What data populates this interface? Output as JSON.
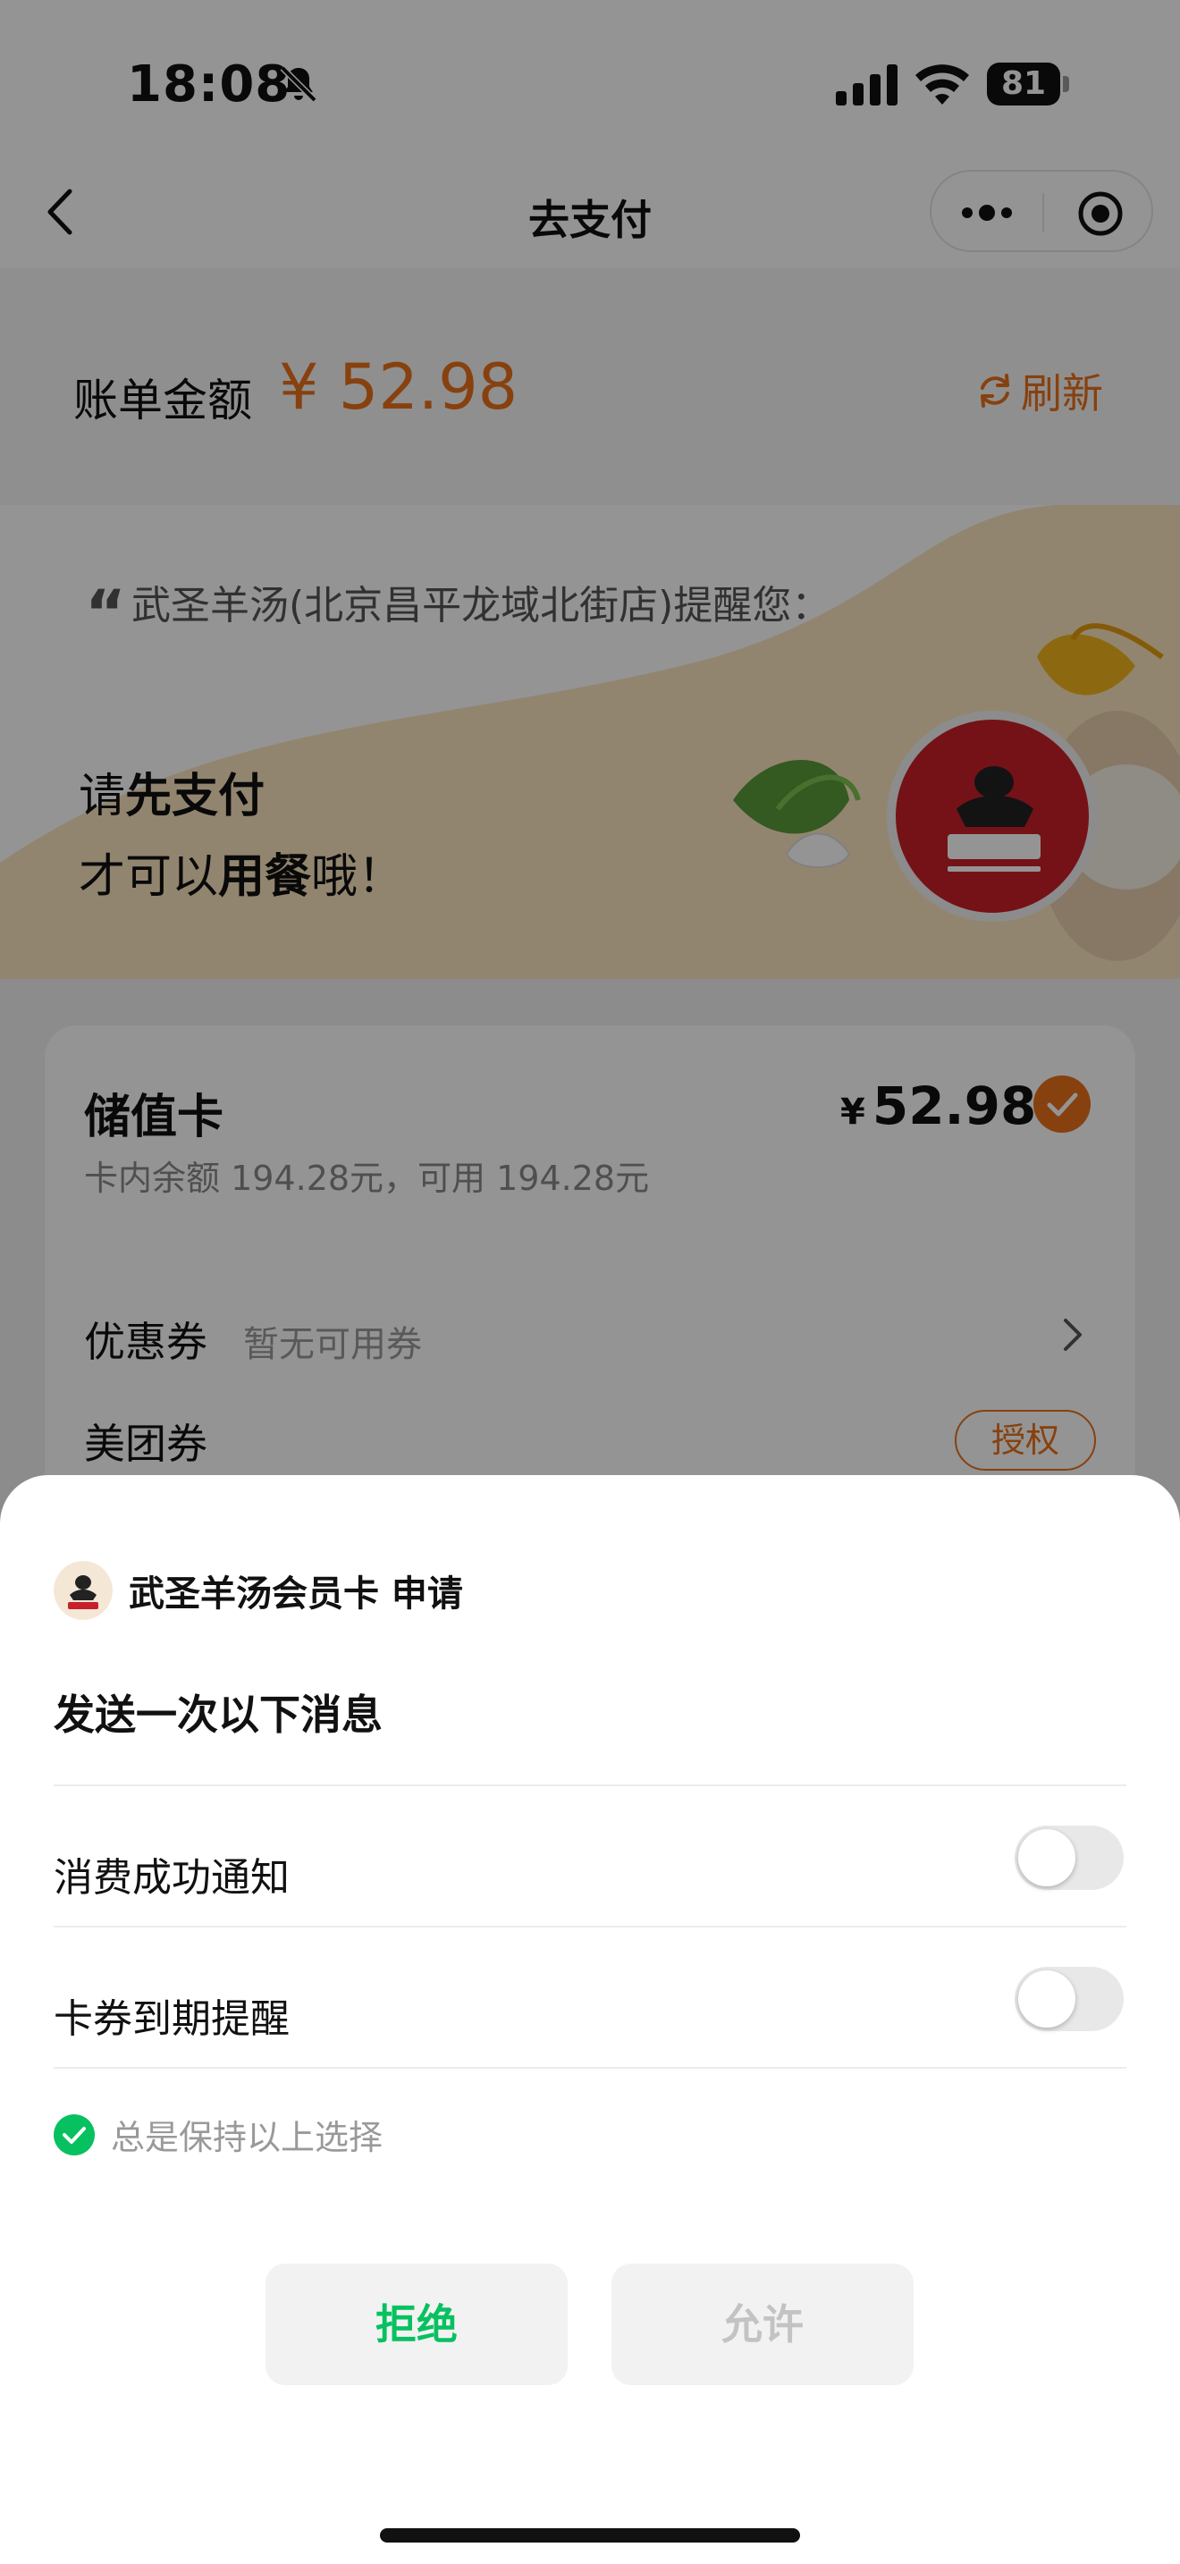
{
  "status_bar": {
    "time": "18:08",
    "battery": "81"
  },
  "nav": {
    "title": "去支付"
  },
  "bill": {
    "label": "账单金额",
    "amount": "¥ 52.98",
    "refresh_label": "刷新"
  },
  "banner": {
    "quote": "武圣羊汤(北京昌平龙域北街店)提醒您：",
    "line1_prefix": "请",
    "line1_strong": "先支付",
    "line2_prefix": "才可以",
    "line2_strong": "用餐",
    "line2_suffix": "哦！"
  },
  "payment": {
    "stored_card_title": "储值卡",
    "stored_card_balance": "卡内余额 194.28元，可用 194.28元",
    "currency": "¥",
    "amount": "52.98",
    "coupon_label": "优惠券",
    "coupon_value": "暂无可用券",
    "meituan_label": "美团券",
    "authorize_label": "授权"
  },
  "sheet": {
    "app_name": "武圣羊汤会员卡  申请",
    "title": "发送一次以下消息",
    "permissions": [
      {
        "label": "消费成功通知",
        "enabled": false
      },
      {
        "label": "卡券到期提醒",
        "enabled": false
      }
    ],
    "keep_selection": "总是保持以上选择",
    "reject_label": "拒绝",
    "allow_label": "允许"
  },
  "colors": {
    "accent_orange": "#e8701a",
    "wechat_green": "#07c160",
    "brand_red": "#c8202a"
  }
}
